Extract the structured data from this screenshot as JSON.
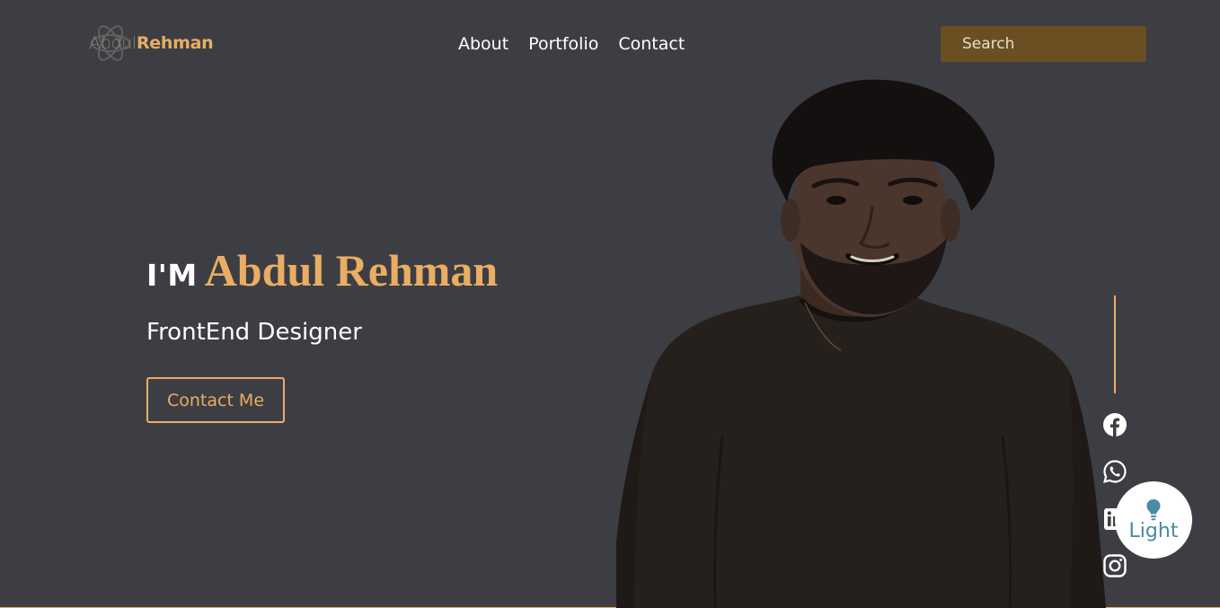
{
  "brand": {
    "first": "Abdul",
    "last": "Rehman"
  },
  "nav": {
    "items": [
      "About",
      "Portfolio",
      "Contact"
    ]
  },
  "search": {
    "placeholder": "Search",
    "icon": "search-icon"
  },
  "hero": {
    "prefix": "I'M",
    "name": "Abdul Rehman",
    "role": "FrontEnd Designer",
    "cta": "Contact Me"
  },
  "social": {
    "icons": [
      "facebook-icon",
      "whatsapp-icon",
      "linkedin-icon",
      "instagram-icon"
    ]
  },
  "theme_toggle": {
    "label": "Light",
    "icon": "lightbulb-icon"
  },
  "colors": {
    "background": "#3d3e44",
    "accent": "#e9ad63",
    "search_bg": "#6b4f22",
    "toggle_text": "#4b8aa5"
  }
}
